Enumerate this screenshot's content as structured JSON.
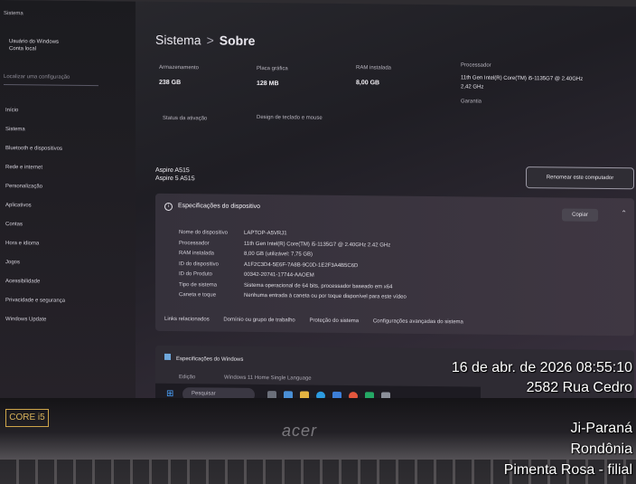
{
  "sidebar": {
    "top_label": "Sistema",
    "user_line1": "Usuário do Windows",
    "user_line2": "Conta local",
    "search_placeholder": "Localizar uma configuração",
    "items": [
      "Início",
      "Sistema",
      "Bluetooth e dispositivos",
      "Rede e internet",
      "Personalização",
      "Aplicativos",
      "Contas",
      "Hora e idioma",
      "Jogos",
      "Acessibilidade",
      "Privacidade e segurança",
      "Windows Update"
    ]
  },
  "breadcrumb": {
    "parent": "Sistema",
    "separator": ">",
    "current": "Sobre"
  },
  "specs": {
    "storage_label": "Armazenamento",
    "storage_value": "238 GB",
    "memory_label": "Placa gráfica",
    "memory_value": "128 MB",
    "ram_label": "RAM instalada",
    "ram_value": "8,00 GB",
    "processor_label": "Processador",
    "processor_value": "11th Gen Intel(R) Core(TM) i5-1135G7 @ 2.40GHz",
    "processor_extra": "2,42 GHz",
    "garantia_label": "Garantia",
    "bottom_left_label": "Status da ativação",
    "bottom_mid_label": "Design de teclado e mouse"
  },
  "device": {
    "name": "Aspire A515",
    "model": "Aspire 5 A515"
  },
  "rename_button": "Renomear este computador",
  "device_specs": {
    "title": "Especificações do dispositivo",
    "copy_label": "Copiar",
    "rows": [
      {
        "key": "Nome do dispositivo",
        "value": "LAPTOP-A5VRJ1"
      },
      {
        "key": "Processador",
        "value": "11th Gen Intel(R) Core(TM) i5-1135G7 @ 2.40GHz   2.42 GHz"
      },
      {
        "key": "RAM instalada",
        "value": "8,00 GB (utilizável: 7,75 GB)"
      },
      {
        "key": "ID do dispositivo",
        "value": "A1F2C3D4-5E6F-7A8B-9C0D-1E2F3A4B5C6D"
      },
      {
        "key": "ID do Produto",
        "value": "00342-20741-17744-AAOEM"
      },
      {
        "key": "Tipo de sistema",
        "value": "Sistema operacional de 64 bits, processador baseado em x64"
      },
      {
        "key": "Caneta e toque",
        "value": "Nenhuma entrada à caneta ou por toque disponível para este vídeo"
      }
    ],
    "links_label": "Links relacionados",
    "links": [
      "Domínio ou grupo de trabalho",
      "Proteção do sistema",
      "Configurações avançadas do sistema"
    ]
  },
  "windows_specs": {
    "title": "Especificações do Windows",
    "edition_key": "Edição",
    "edition_value": "Windows 11 Home Single Language"
  },
  "taskbar": {
    "search_placeholder": "Pesquisar"
  },
  "laptop": {
    "brand": "acer",
    "sticker": "CORE i5"
  },
  "stamp": {
    "datetime": "16 de abr. de 2026 08:55:10",
    "street": "2582 Rua Cedro",
    "district": "Ji-Paraná",
    "state": "Rondônia",
    "place": "Pimenta Rosa - filial"
  },
  "colors": {
    "accent": "#4aa3ff",
    "stamp_text": "#ffffff"
  }
}
